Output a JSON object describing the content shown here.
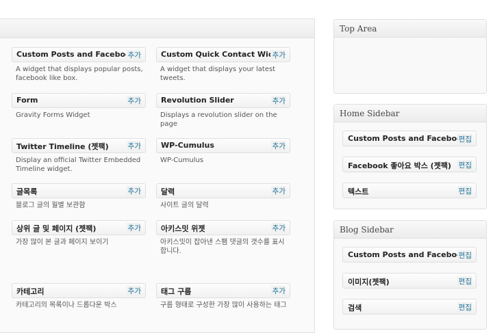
{
  "available_widgets": [
    {
      "title": "Custom Posts and Facebook Tabs",
      "action": "추가",
      "desc": "A widget that displays popular posts, facebook like box."
    },
    {
      "title": "Custom Quick Contact Widget",
      "action": "추가",
      "desc": "A widget that displays your latest tweets."
    },
    {
      "title": "Form",
      "action": "추가",
      "desc": "Gravity Forms Widget"
    },
    {
      "title": "Revolution Slider",
      "action": "추가",
      "desc": "Displays a revolution slider on the page"
    },
    {
      "title": "Twitter Timeline (젯팩)",
      "action": "추가",
      "desc": "Display an official Twitter Embedded Timeline widget."
    },
    {
      "title": "WP-Cumulus",
      "action": "추가",
      "desc": "WP-Cumulus"
    },
    {
      "title": "글목록",
      "action": "추가",
      "desc": "블로그 글의 월별 보관함"
    },
    {
      "title": "달력",
      "action": "추가",
      "desc": "사이트 글의 달력"
    },
    {
      "title": "상위 글 및 페이지 (젯팩)",
      "action": "추가",
      "desc": "가장 많이 본 글과 페이지 보이기"
    },
    {
      "title": "아키스밋 위젯",
      "action": "추가",
      "desc": "아키스밋이 잡아낸 스팸 댓글의 갯수를 표시합니다."
    },
    {
      "title": "카테고리",
      "action": "추가",
      "desc": "카테고리의 목록이나 드롭다운 박스"
    },
    {
      "title": "태그 구름",
      "action": "추가",
      "desc": "구름 형태로 구성한 가장 많이 사용하는 태그"
    }
  ],
  "sidebars": [
    {
      "name": "Top Area",
      "widgets": []
    },
    {
      "name": "Home Sidebar",
      "widgets": [
        {
          "title": "Custom Posts and Facebook Tabs",
          "action": "편집"
        },
        {
          "title": "Facebook 좋아요 박스 (젯팩)",
          "action": "편집"
        },
        {
          "title": "텍스트",
          "action": "편집"
        }
      ]
    },
    {
      "name": "Blog Sidebar",
      "widgets": [
        {
          "title": "Custom Posts and Facebook Tabs",
          "action": "편집"
        },
        {
          "title": "이미지(젯팩)",
          "action": "편집"
        },
        {
          "title": "검색",
          "action": "편집"
        }
      ]
    }
  ],
  "colors": {
    "link": "#21759b",
    "border": "#dfdfdf"
  }
}
